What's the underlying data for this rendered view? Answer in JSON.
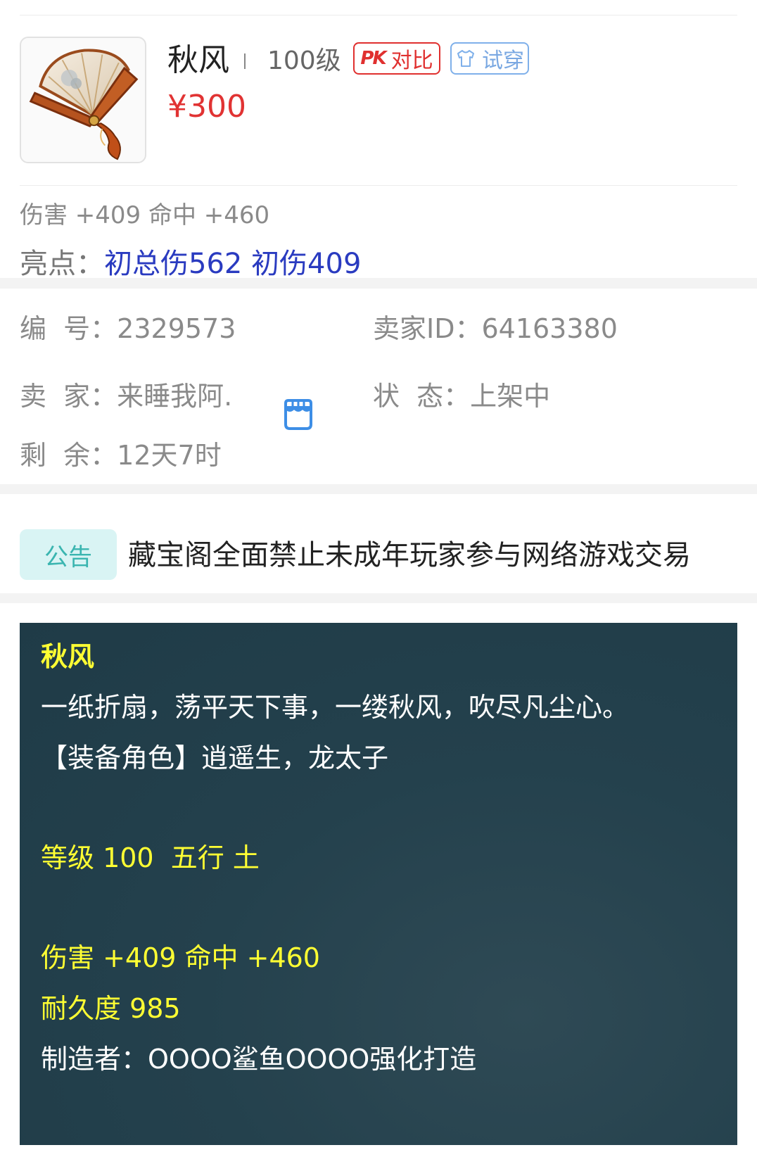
{
  "item": {
    "name": "秋风",
    "level": "100级",
    "price": "¥300",
    "thumbnail_icon": "folding-fan"
  },
  "actions": {
    "pk_icon": "PK",
    "pk_label": "对比",
    "try_on_label": "试穿"
  },
  "summary": {
    "stats": "伤害 +409 命中 +460",
    "highlight_label": "亮点：",
    "highlight_value": "初总伤562 初伤409"
  },
  "info": {
    "id_label": "编  号：",
    "id_value": "2329573",
    "seller_id_label": "卖家ID：",
    "seller_id_value": "64163380",
    "seller_label": "卖  家：",
    "seller_value": "来睡我阿.",
    "status_label": "状  态：",
    "status_value": "上架中",
    "remaining_label": "剩  余：",
    "remaining_value": "12天7时"
  },
  "notice": {
    "badge": "公告",
    "text": "藏宝阁全面禁止未成年玩家参与网络游戏交易"
  },
  "description": {
    "title": "秋风",
    "flavor": "一纸折扇，荡平天下事，一缕秋风，吹尽凡尘心。",
    "roles": "【装备角色】逍遥生，龙太子",
    "level_element": "等级 100  五行 土",
    "stats": "伤害 +409 命中 +460",
    "durability": "耐久度 985",
    "maker": "制造者：OOOO鲨鱼OOOO强化打造"
  },
  "colors": {
    "price_red": "#e13333",
    "highlight_blue": "#2a3bc0",
    "notice_teal": "#3ab5b0",
    "panel_bg": "#24414d",
    "desc_yellow": "#ffff33"
  }
}
